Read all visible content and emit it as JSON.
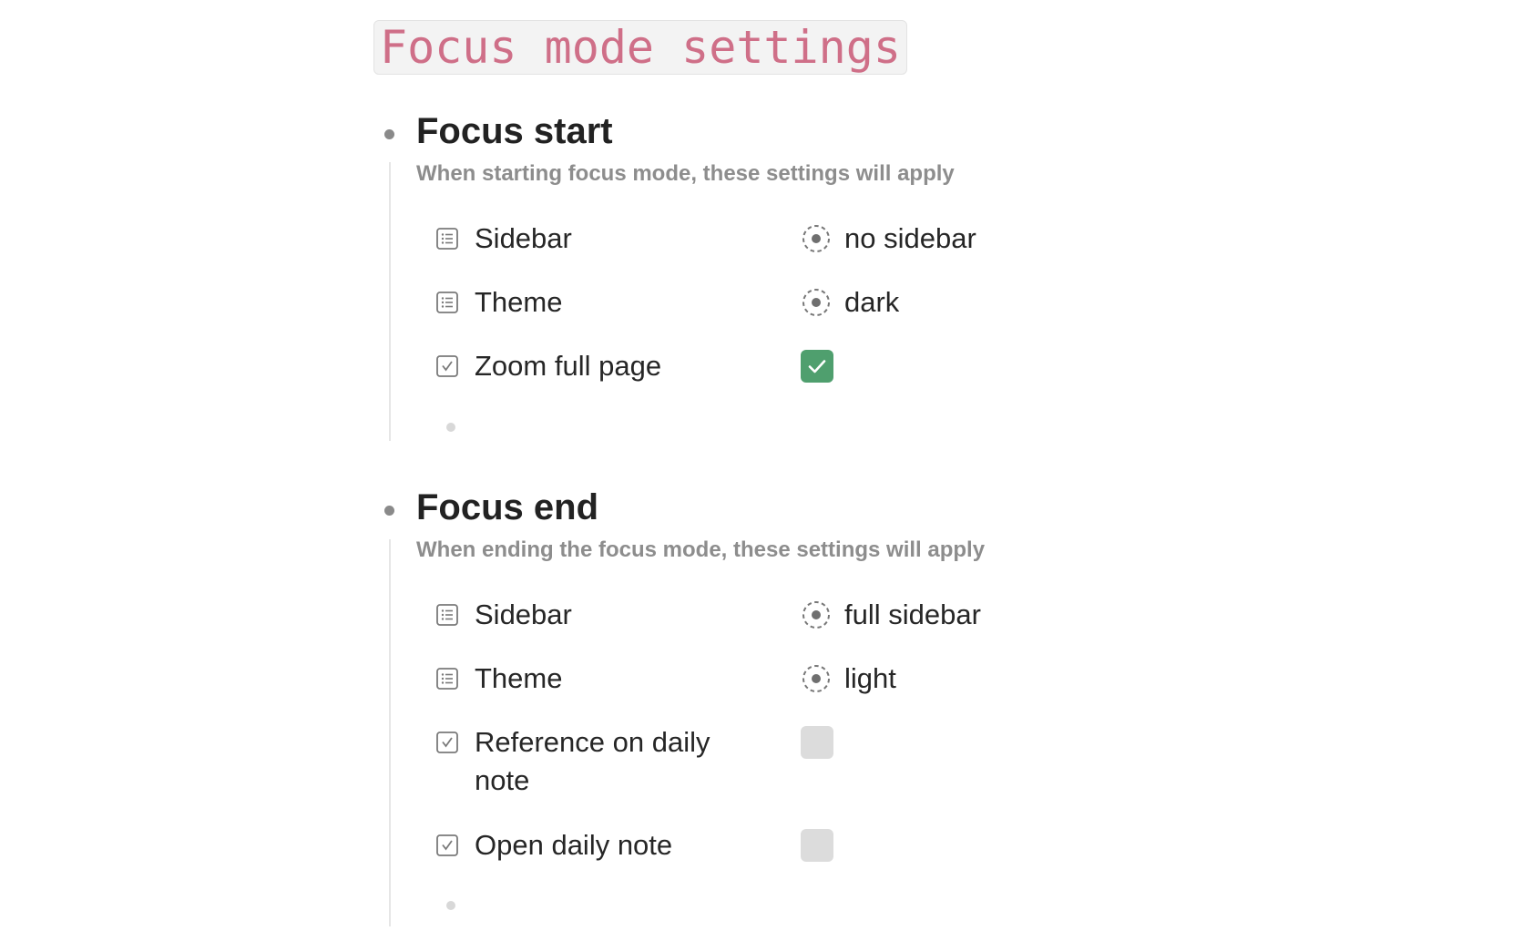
{
  "page": {
    "title": "Focus mode settings"
  },
  "colors": {
    "title_text": "#cf6f88",
    "title_bg": "#f3f3f3",
    "checkbox_checked": "#4f9f6e",
    "checkbox_unchecked": "#dcdcdc",
    "description_text": "#8d8d8d"
  },
  "focus_start": {
    "heading": "Focus start",
    "description": "When starting focus mode, these settings will apply",
    "rows": [
      {
        "label": "Sidebar",
        "type": "select",
        "value": "no sidebar",
        "icon": "list-icon"
      },
      {
        "label": "Theme",
        "type": "select",
        "value": "dark",
        "icon": "list-icon"
      },
      {
        "label": "Zoom full page",
        "type": "checkbox",
        "checked": true,
        "icon": "checkbox-icon"
      }
    ]
  },
  "focus_end": {
    "heading": "Focus end",
    "description": "When ending the focus mode, these settings will apply",
    "rows": [
      {
        "label": "Sidebar",
        "type": "select",
        "value": "full sidebar",
        "icon": "list-icon"
      },
      {
        "label": "Theme",
        "type": "select",
        "value": "light",
        "icon": "list-icon"
      },
      {
        "label": "Reference on daily note",
        "type": "checkbox",
        "checked": false,
        "icon": "checkbox-icon"
      },
      {
        "label": "Open daily note",
        "type": "checkbox",
        "checked": false,
        "icon": "checkbox-icon"
      }
    ]
  }
}
